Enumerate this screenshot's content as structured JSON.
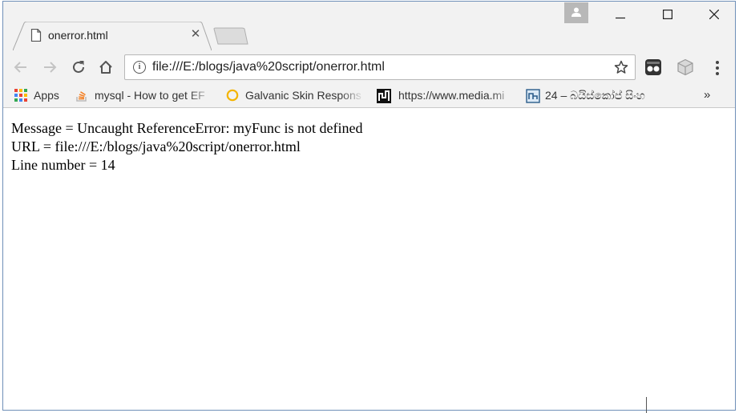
{
  "tab": {
    "title": "onerror.html",
    "close_symbol": "✕",
    "icon": "page-icon"
  },
  "window_controls": {
    "profile_icon": "person-icon",
    "minimize_icon": "minimize-icon",
    "maximize_icon": "maximize-icon",
    "close_icon": "close-icon"
  },
  "toolbar": {
    "back_icon": "back-arrow-icon",
    "forward_icon": "forward-arrow-icon",
    "reload_icon": "reload-icon",
    "home_icon": "home-icon",
    "info_symbol": "i",
    "url": "file:///E:/blogs/java%20script/onerror.html",
    "star_icon": "bookmark-star-icon",
    "extensions": [
      "tampermonkey-icon",
      "cube-extension-icon"
    ],
    "menu_icon": "more-vert-icon"
  },
  "bookmarks": {
    "items": [
      {
        "label": "Apps",
        "icon": "apps-grid-icon"
      },
      {
        "label": "mysql - How to get EF",
        "icon": "stackoverflow-icon"
      },
      {
        "label": "Galvanic Skin Respons",
        "icon": "ring-icon"
      },
      {
        "label": "https://www.media.mi",
        "icon": "media-logo-icon"
      },
      {
        "label": "24 – බයිස්කෝප් සිංහ",
        "icon": "site-logo-icon"
      }
    ],
    "more_symbol": "»"
  },
  "page": {
    "lines": [
      "Message = Uncaught ReferenceError: myFunc is not defined",
      "URL = file:///E:/blogs/java%20script/onerror.html",
      "Line number = 14"
    ]
  },
  "colors": {
    "chrome_bg": "#f2f2f2",
    "window_border": "#6f8fb8",
    "content_bg": "#ffffff"
  }
}
